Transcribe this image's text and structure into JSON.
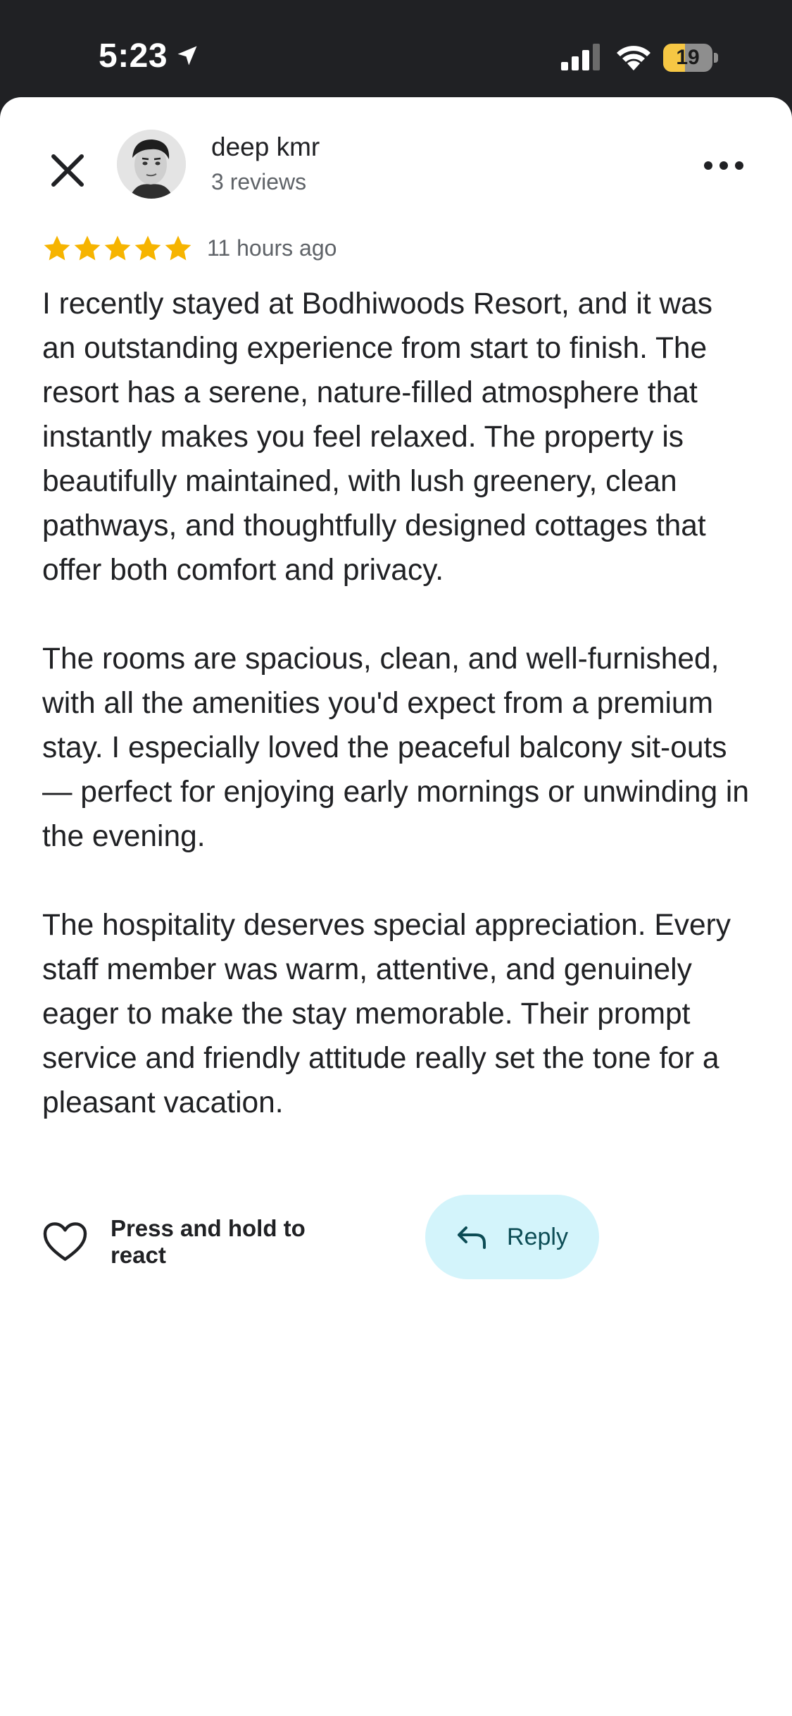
{
  "status_bar": {
    "time": "5:23",
    "battery_level": "19",
    "icons": [
      "location-arrow-icon",
      "cellular-signal-icon",
      "wifi-icon",
      "battery-icon"
    ]
  },
  "header": {
    "close_icon": "close-icon",
    "user_name": "deep kmr",
    "user_reviews": "3 reviews",
    "more_icon": "more-options-icon"
  },
  "rating": {
    "stars": 5,
    "max_stars": 5,
    "star_color": "#f6b400",
    "time_ago": "11 hours ago"
  },
  "review": {
    "paragraphs": [
      "I recently stayed at Bodhiwoods Resort, and it was an outstanding experience from start to finish. The resort has a serene, nature-filled atmosphere that instantly makes you feel relaxed. The property is beautifully maintained, with lush greenery, clean pathways, and thoughtfully designed cottages that offer both comfort and privacy.",
      "The rooms are spacious, clean, and well-furnished, with all the amenities you'd expect from a premium stay. I especially loved the peaceful balcony sit-outs — perfect for enjoying early mornings or unwinding in the evening.",
      "The hospitality deserves special appreciation. Every staff member was warm, attentive, and genuinely eager to make the stay memorable. Their prompt service and friendly attitude really set the tone for a pleasant vacation."
    ]
  },
  "actions": {
    "react_label": "Press and hold to react",
    "react_icon": "heart-icon",
    "reply_label": "Reply",
    "reply_icon": "reply-arrow-icon",
    "reply_bg_color": "#d3f4fb"
  }
}
